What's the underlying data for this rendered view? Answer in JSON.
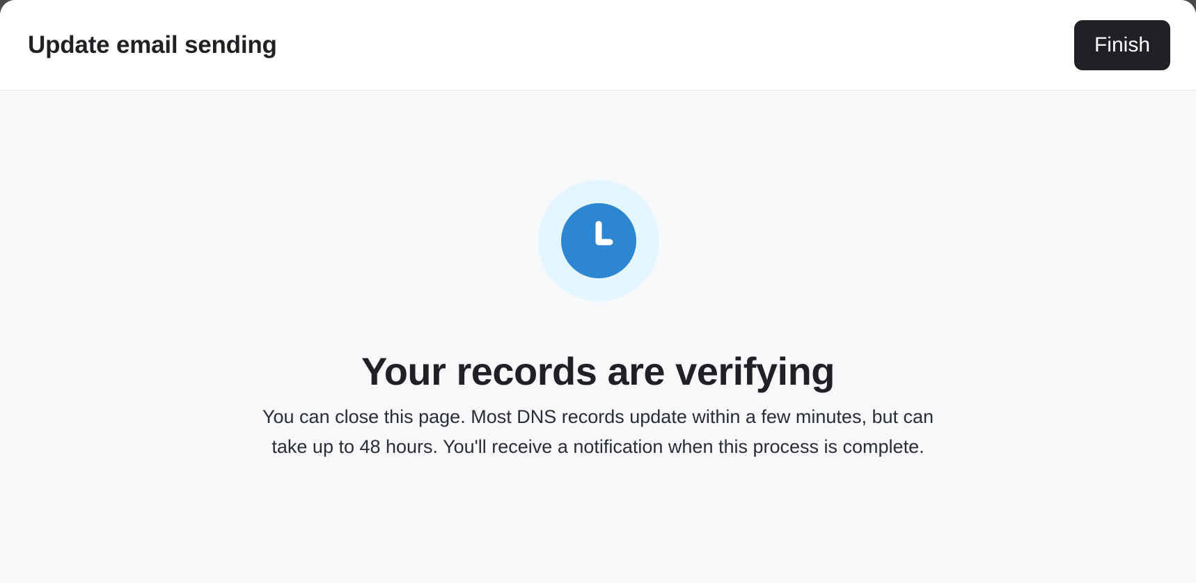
{
  "header": {
    "title": "Update email sending",
    "finish_label": "Finish"
  },
  "status": {
    "icon": "clock-icon",
    "headline": "Your records are verifying",
    "description": "You can close this page. Most DNS records update within a few minutes, but can take up to 48 hours. You'll receive a notification when this process is complete."
  },
  "colors": {
    "icon_halo": "#e3f6fd",
    "icon_fill": "#2e86d1",
    "button_bg": "#1f2124",
    "page_bg": "#f7f8fa"
  }
}
